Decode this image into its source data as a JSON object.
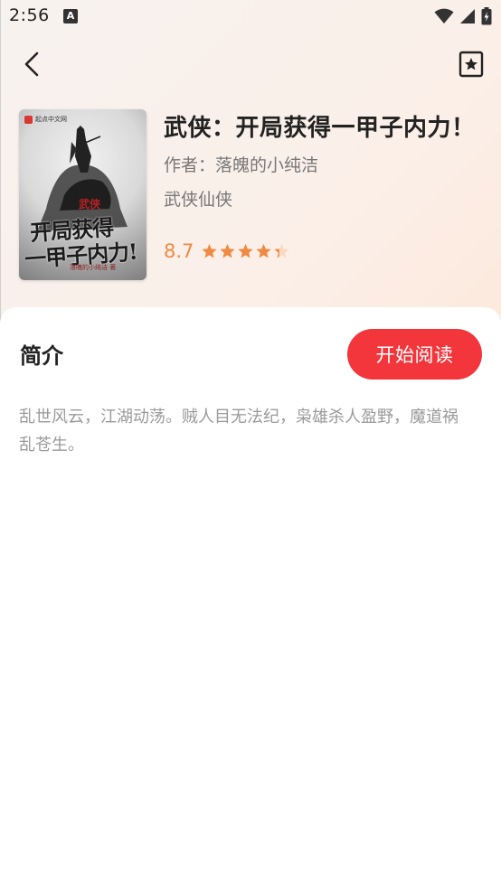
{
  "status_bar": {
    "time": "2:56",
    "notification_icon": "a-icon",
    "icons": [
      "wifi-icon",
      "signal-icon",
      "battery-icon"
    ]
  },
  "topbar": {
    "back_icon": "chevron-left-icon",
    "bookmark_icon": "bookmark-star-icon"
  },
  "book": {
    "title": "武侠：开局获得一甲子内力！",
    "author_label": "作者：",
    "author": "落魄的小纯洁",
    "genre": "武侠仙侠",
    "rating": "8.7",
    "rating_fraction": 0.87,
    "cover": {
      "publisher": "起点中文网",
      "tag": "武侠",
      "title_line1": "开局获得",
      "title_line2": "一甲子内力!",
      "author": "落魄的小纯洁 著"
    }
  },
  "intro": {
    "heading": "简介",
    "start_button": "开始阅读",
    "description": "乱世风云，江湖动荡。贼人目无法纪，枭雄杀人盈野，魔道祸乱苍生。"
  },
  "colors": {
    "accent": "#f2363b",
    "rating": "#f08a42"
  }
}
